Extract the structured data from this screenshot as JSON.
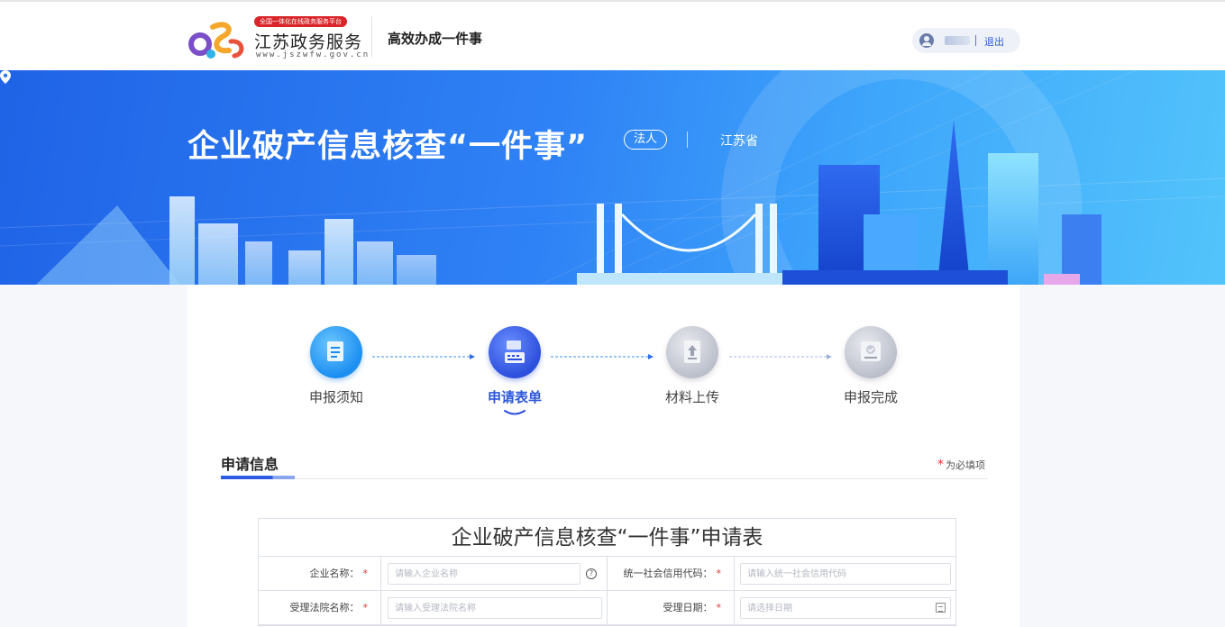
{
  "header": {
    "logo_badge": "全国一体化在线政务服务平台",
    "logo_name": "江苏政务服务",
    "logo_url": "www.jszwfw.gov.cn",
    "slogan": "高效办成一件事",
    "logout_label": "退出"
  },
  "banner": {
    "title": "企业破产信息核查“一件事”",
    "tag": "法人",
    "location": "江苏省"
  },
  "steps": [
    {
      "label": "申报须知",
      "state": "done",
      "icon": "notice-icon"
    },
    {
      "label": "申请表单",
      "state": "active",
      "icon": "form-icon"
    },
    {
      "label": "材料上传",
      "state": "todo",
      "icon": "upload-icon"
    },
    {
      "label": "申报完成",
      "state": "todo",
      "icon": "complete-icon"
    }
  ],
  "section": {
    "title": "申请信息",
    "required_note": "为必填项"
  },
  "form": {
    "title": "企业破产信息核查“一件事”申请表",
    "rows": [
      {
        "left_label": "企业名称：",
        "left_placeholder": "请输入企业名称",
        "left_help": "?",
        "right_label": "统一社会信用代码：",
        "right_placeholder": "请输入统一社会信用代码"
      },
      {
        "left_label": "受理法院名称：",
        "left_placeholder": "请输入受理法院名称",
        "right_label": "受理日期：",
        "right_placeholder": "请选择日期"
      }
    ]
  },
  "colors": {
    "brand_blue": "#2d5be3",
    "required_red": "#e33333",
    "banner_start": "#1f63e6",
    "banner_end": "#53c4fb"
  }
}
